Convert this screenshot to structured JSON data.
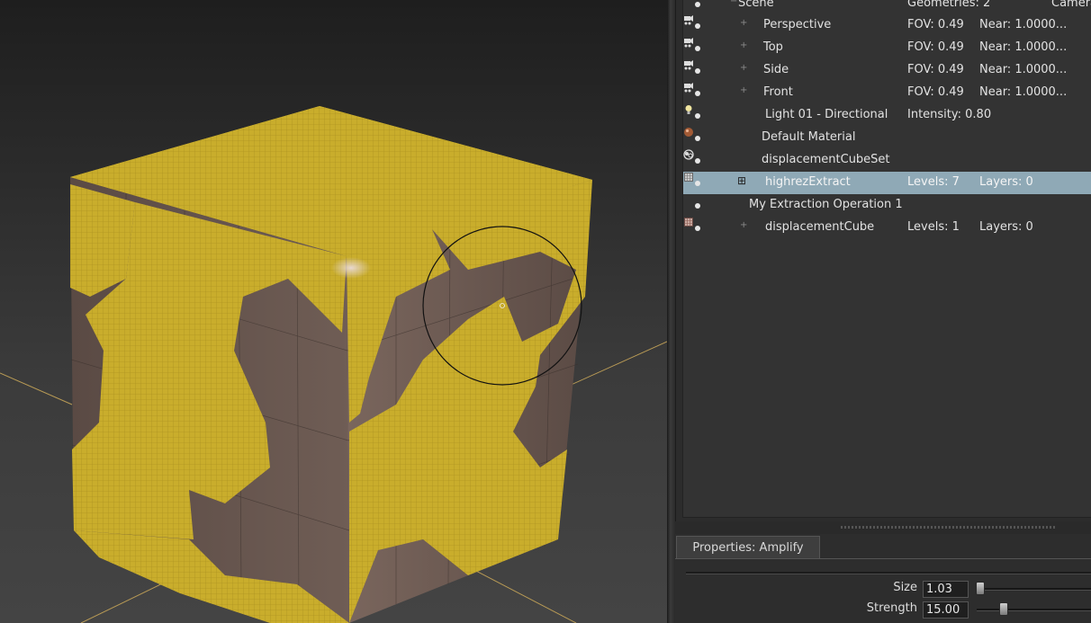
{
  "outliner": {
    "rows": [
      {
        "name": "Scene",
        "tree": "−",
        "col2": "Geometries: 2",
        "col3": "",
        "col4": "Camera",
        "icon": "none"
      },
      {
        "name": "Perspective",
        "tree": "+",
        "col2": "FOV: 0.49",
        "col3": "Near: 1.0000...",
        "col4": "",
        "icon": "camera-icon"
      },
      {
        "name": "Top",
        "tree": "+",
        "col2": "FOV: 0.49",
        "col3": "Near: 1.0000...",
        "col4": "",
        "icon": "camera-icon"
      },
      {
        "name": "Side",
        "tree": "+",
        "col2": "FOV: 0.49",
        "col3": "Near: 1.0000...",
        "col4": "",
        "icon": "camera-icon"
      },
      {
        "name": "Front",
        "tree": "+",
        "col2": "FOV: 0.49",
        "col3": "Near: 1.0000...",
        "col4": "",
        "icon": "camera-icon"
      },
      {
        "name": "Light 01 - Directional",
        "tree": "",
        "col2": "Intensity: 0.80",
        "col3": "",
        "col4": "",
        "icon": "light-bulb-icon"
      },
      {
        "name": "Default Material",
        "tree": "",
        "col2": "",
        "col3": "",
        "col4": "",
        "icon": "material-sphere-icon"
      },
      {
        "name": "displacementCubeSet",
        "tree": "",
        "col2": "",
        "col3": "",
        "col4": "",
        "icon": "set-icon"
      },
      {
        "name": "highrezExtract",
        "tree": "⊞",
        "col2": "Levels: 7",
        "col3": "Layers: 0",
        "col4": "",
        "icon": "mesh-icon",
        "selected": true
      },
      {
        "name": "My Extraction Operation 1",
        "tree": "",
        "col2": "",
        "col3": "",
        "col4": "",
        "icon": "none"
      },
      {
        "name": "displacementCube",
        "tree": "+",
        "col2": "Levels: 1",
        "col3": "Layers: 0",
        "col4": "",
        "icon": "mesh-icon"
      }
    ]
  },
  "properties": {
    "tab_label": "Properties: Amplify",
    "size_label": "Size",
    "size_value": "1.03",
    "strength_label": "Strength",
    "strength_value": "15.00"
  },
  "colors": {
    "selection": "#8fa9b6",
    "displacement_yellow": "#c9ad2c",
    "cube_base": "#6e5c54"
  }
}
